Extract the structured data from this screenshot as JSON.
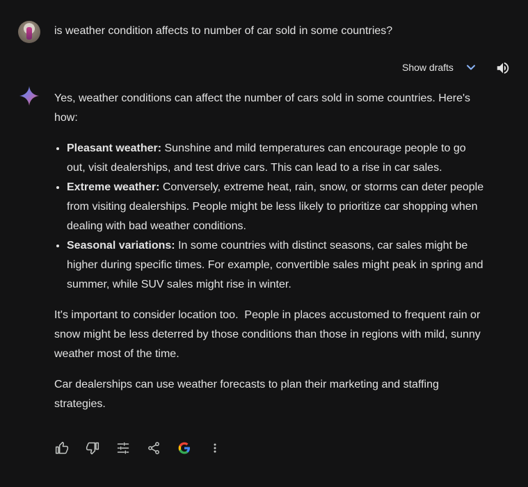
{
  "user": {
    "prompt": "is weather condition affects to number of car sold in some countries?"
  },
  "drafts": {
    "label": "Show drafts"
  },
  "response": {
    "intro": "Yes, weather conditions can affect the number of cars sold in some countries. Here's how:",
    "bullets": [
      {
        "title": "Pleasant weather:",
        "text": " Sunshine and mild temperatures can encourage people to go out, visit dealerships, and test drive cars. This can lead to a rise in car sales."
      },
      {
        "title": "Extreme weather:",
        "text": " Conversely, extreme heat, rain, snow, or storms can deter people from visiting dealerships. People might be less likely to prioritize car shopping when dealing with bad weather conditions."
      },
      {
        "title": "Seasonal variations:",
        "text": " In some countries with distinct seasons, car sales might be higher during specific times. For example, convertible sales might peak in spring and summer, while SUV sales might rise in winter."
      }
    ],
    "paragraph2": "It's important to consider location too.  People in places accustomed to frequent rain or snow might be less deterred by those conditions than those in regions with mild, sunny weather most of the time.",
    "paragraph3": "Car dealerships can use weather forecasts to plan their marketing and staffing strategies."
  },
  "icons": {
    "avatar": "user-avatar",
    "spark": "gemini-spark-icon",
    "speaker": "speaker-icon",
    "chevron": "chevron-down-icon",
    "actions": [
      "thumbs-up-icon",
      "thumbs-down-icon",
      "tune-icon",
      "share-icon",
      "google-icon",
      "more-vert-icon"
    ]
  },
  "colors": {
    "background": "#131314",
    "text": "#e3e3e3",
    "accent": "#8ab4f8"
  }
}
